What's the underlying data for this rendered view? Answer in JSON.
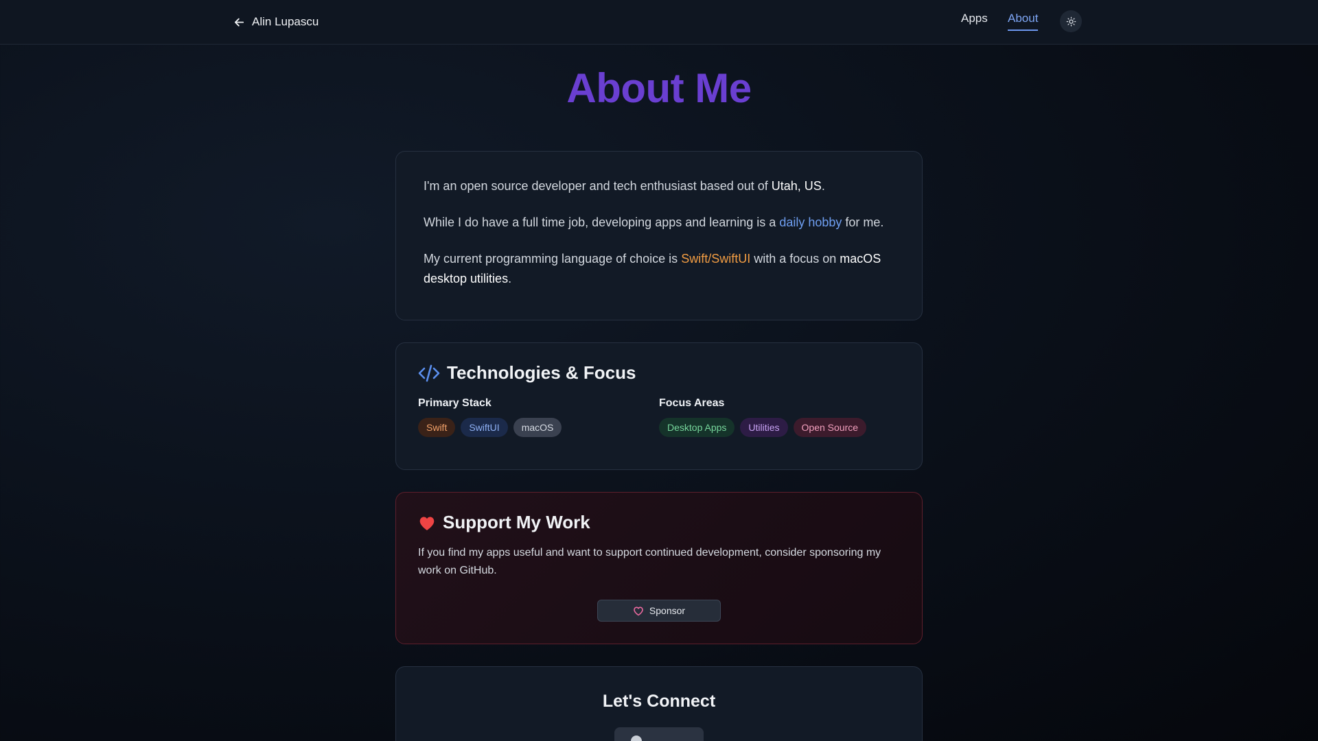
{
  "header": {
    "back_label": "Alin Lupascu",
    "nav": {
      "apps": "Apps",
      "about": "About"
    },
    "theme_toggle_icon": "sun-icon"
  },
  "page": {
    "title": "About Me"
  },
  "intro": {
    "p1": {
      "before": "I'm an open source developer and tech enthusiast based out of ",
      "highlight": "Utah, US",
      "after": "."
    },
    "p2": {
      "before": "While I do have a full time job, developing apps and learning is a ",
      "highlight": "daily hobby",
      "after": " for me."
    },
    "p3": {
      "before": "My current programming language of choice is ",
      "highlight1": "Swift/SwiftUI",
      "middle": " with a focus on ",
      "highlight2": "macOS desktop utilities",
      "after": "."
    }
  },
  "tech": {
    "title": "Technologies & Focus",
    "icon": "code-icon",
    "primary_label": "Primary Stack",
    "primary": [
      "Swift",
      "SwiftUI",
      "macOS"
    ],
    "focus_label": "Focus Areas",
    "focus": [
      "Desktop Apps",
      "Utilities",
      "Open Source"
    ]
  },
  "support": {
    "title": "Support My Work",
    "icon": "heart-icon",
    "text": "If you find my apps useful and want to support continued development, consider sponsoring my work on GitHub.",
    "button": "Sponsor"
  },
  "connect": {
    "title": "Let's Connect",
    "button_icon": "github-icon"
  },
  "colors": {
    "accent": "#6a3fd1",
    "link_blue": "#6f9ff2",
    "highlight_orange": "#f29d43",
    "heart_red": "#ef4444"
  }
}
